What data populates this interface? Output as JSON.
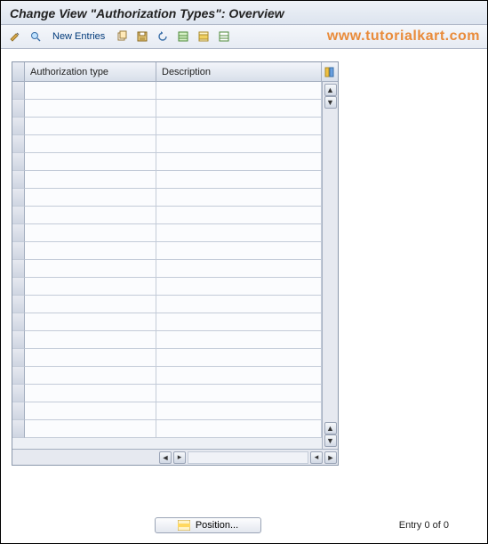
{
  "title": "Change View \"Authorization Types\": Overview",
  "toolbar": {
    "new_entries_label": "New Entries"
  },
  "watermark": "www.tutorialkart.com",
  "table": {
    "columns": {
      "c1": "Authorization type",
      "c2": "Description"
    },
    "row_count": 20
  },
  "footer": {
    "position_label": "Position...",
    "entry_text": "Entry 0 of 0"
  }
}
